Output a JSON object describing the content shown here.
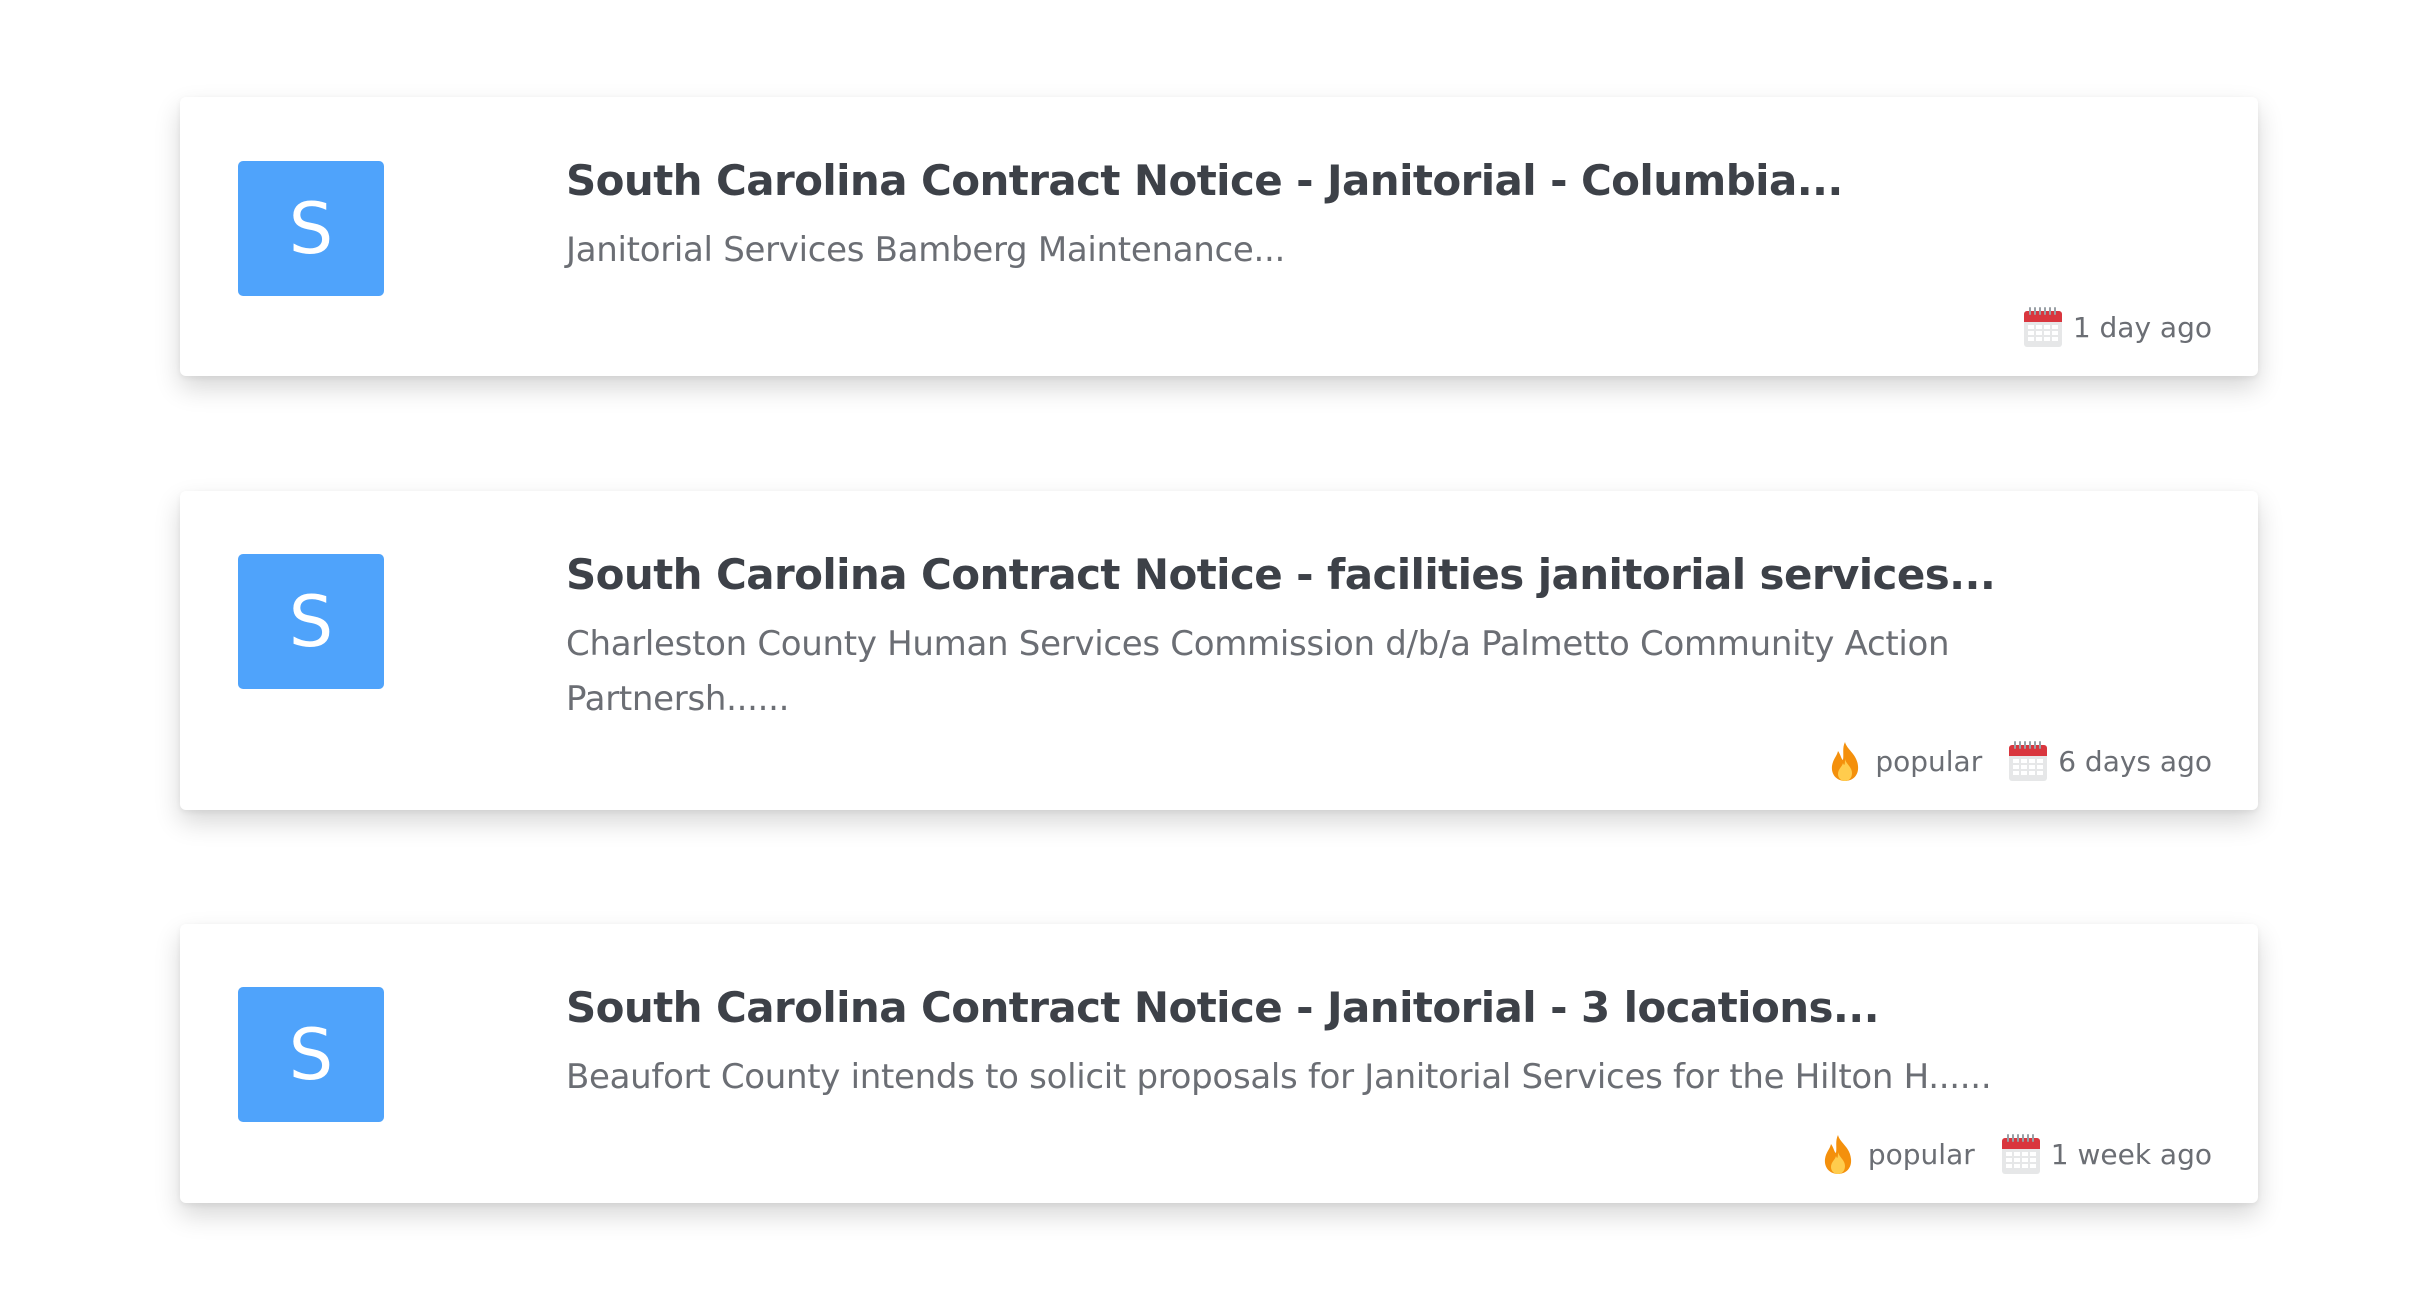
{
  "colors": {
    "avatar_bg": "#4fa3fb",
    "title": "#3d4148",
    "text_muted": "#6b6e74",
    "calendar_red": "#d9363e",
    "fire_orange": "#f4900c",
    "fire_yellow": "#ffcc4d"
  },
  "icons": {
    "calendar": "calendar-icon",
    "popular": "fire-icon"
  },
  "notices": [
    {
      "avatar_letter": "S",
      "title": "South Carolina Contract Notice - Janitorial - Columbia...",
      "description": "Janitorial Services Bamberg Maintenance...",
      "popular_label": "",
      "date_label": "1 day ago"
    },
    {
      "avatar_letter": "S",
      "title": "South Carolina Contract Notice - facilities janitorial services...",
      "description": "Charleston County Human Services Commission d/b/a Palmetto Community Action Partnersh......",
      "popular_label": "popular",
      "date_label": "6 days ago"
    },
    {
      "avatar_letter": "S",
      "title": "South Carolina Contract Notice - Janitorial - 3 locations...",
      "description": "Beaufort County intends to solicit proposals for Janitorial Services for the Hilton H......",
      "popular_label": "popular",
      "date_label": "1 week ago"
    }
  ]
}
